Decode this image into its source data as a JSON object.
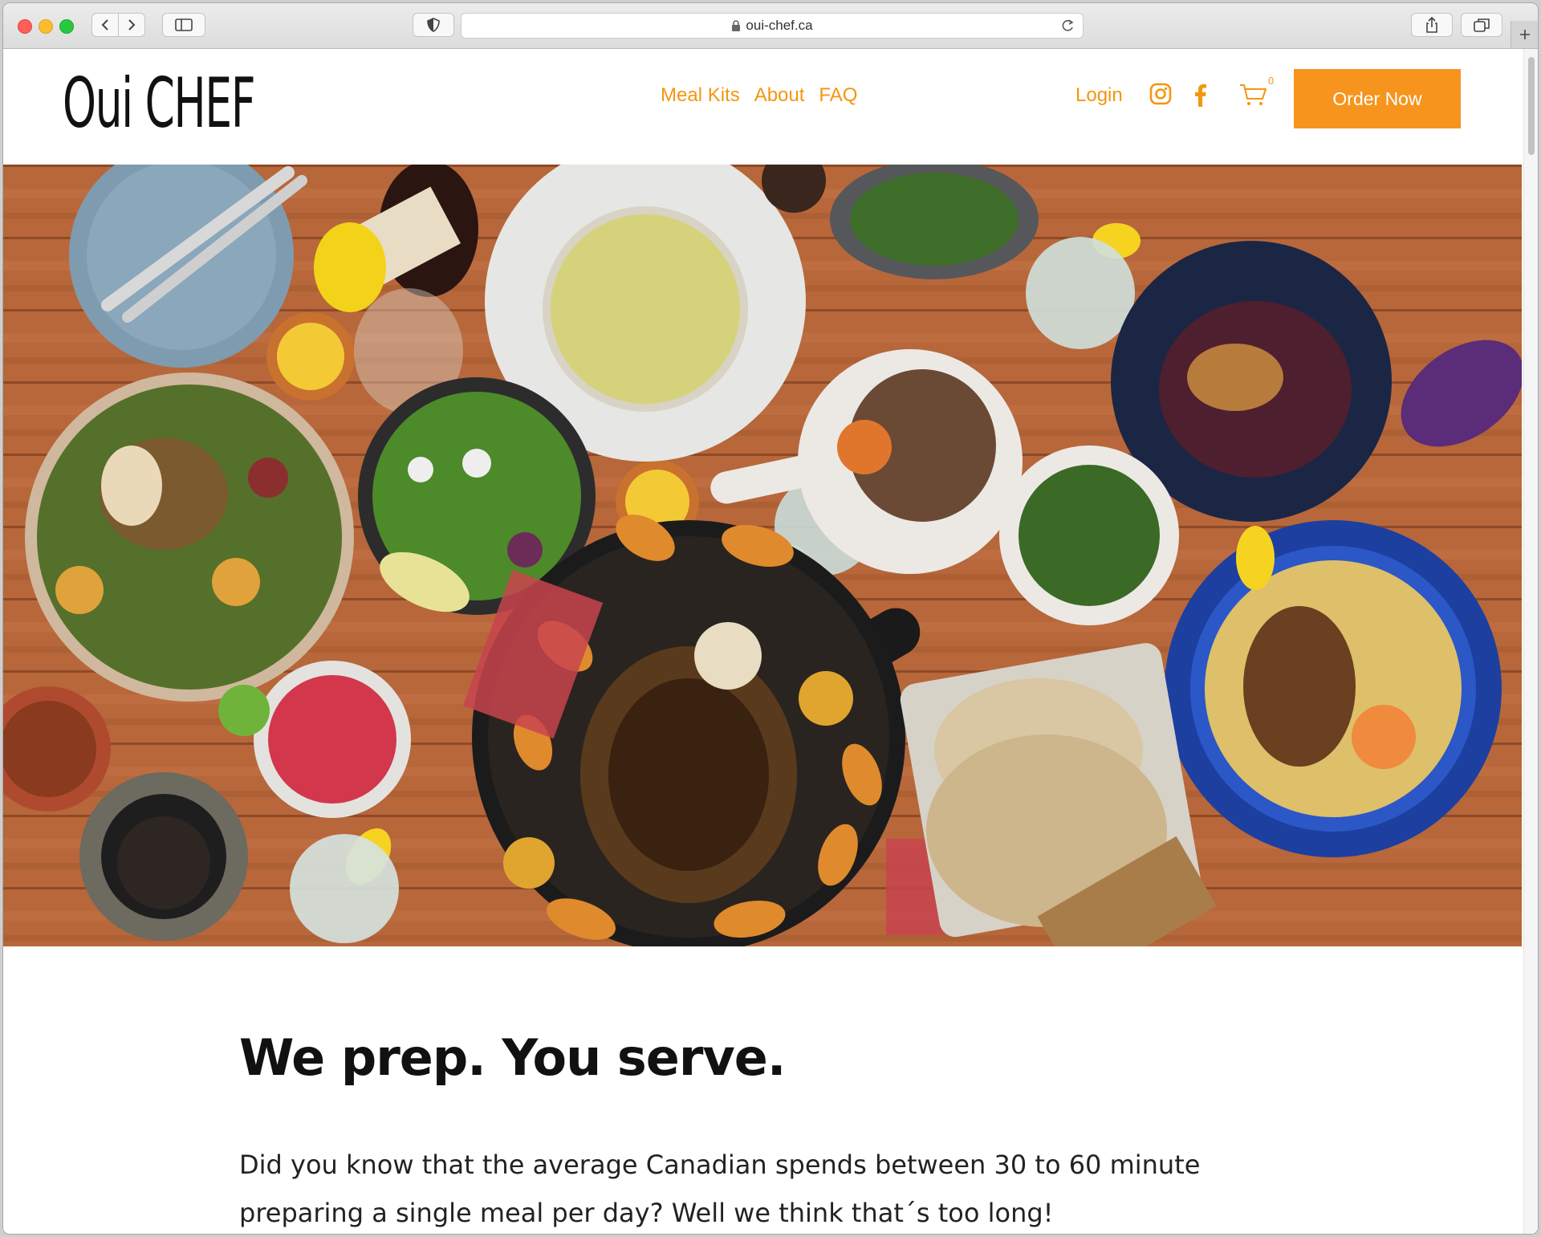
{
  "browser": {
    "url": "oui-chef.ca"
  },
  "site": {
    "logo": "Oui CHEF",
    "nav": [
      "Meal Kits",
      "About",
      "FAQ"
    ],
    "login": "Login",
    "cart_count": "0",
    "order_button": "Order Now",
    "brand_color": "#f7941d"
  },
  "icons": {
    "social": [
      "instagram-icon",
      "facebook-icon"
    ],
    "cart": "cart-icon"
  },
  "content": {
    "headline": "We prep. You serve.",
    "intro": "Did you know that the average Canadian spends between 30 to 60 minute preparing a single meal per day? Well we think that´s too long!"
  }
}
